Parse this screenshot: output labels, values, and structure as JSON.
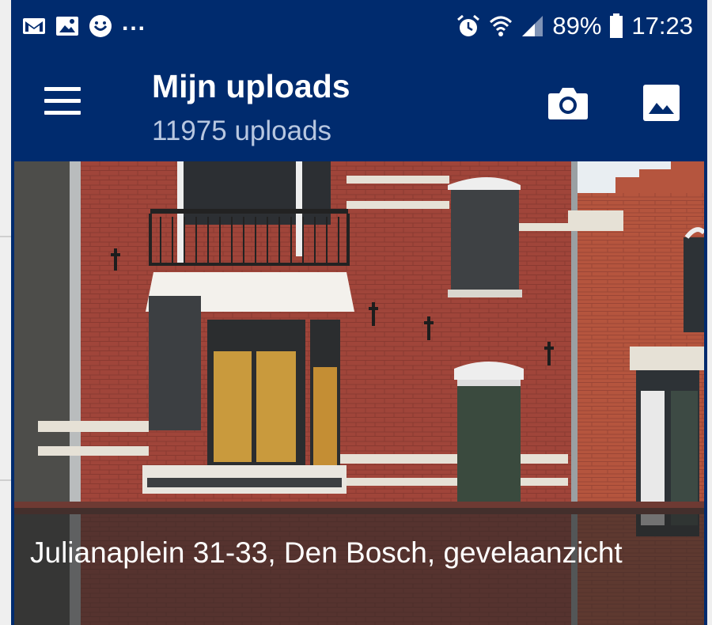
{
  "statusbar": {
    "notification_icons": [
      "gmail-icon",
      "image-icon",
      "smiley-icon"
    ],
    "more": "...",
    "battery": "89%",
    "time": "17:23"
  },
  "appbar": {
    "title": "Mijn uploads",
    "subtitle": "11975 uploads"
  },
  "photo": {
    "caption": "Julianaplein 31-33, Den Bosch, gevelaanzicht"
  },
  "colors": {
    "primary": "#002b6e",
    "subtitle": "#b8c7e0"
  }
}
